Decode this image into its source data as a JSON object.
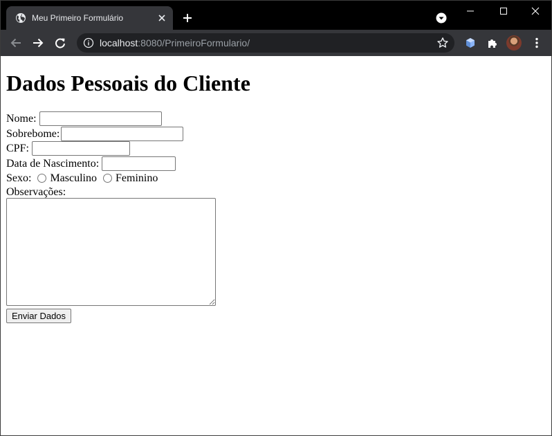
{
  "browser": {
    "tab_title": "Meu Primeiro Formulário",
    "url_host": "localhost",
    "url_rest": ":8080/PrimeiroFormulario/"
  },
  "page": {
    "heading": "Dados Pessoais do Cliente",
    "form": {
      "nome_label": "Nome:",
      "sobrenome_label": "Sobrebome:",
      "cpf_label": "CPF:",
      "nascimento_label": "Data de Nascimento:",
      "sexo_label": "Sexo:",
      "masculino_label": "Masculino",
      "feminino_label": "Feminino",
      "observacoes_label": "Observações:",
      "submit_label": "Enviar Dados",
      "nome_value": "",
      "sobrenome_value": "",
      "cpf_value": "",
      "nascimento_value": "",
      "observacoes_value": ""
    }
  },
  "icons": {
    "tab": "globe-icon",
    "tab_close": "close-icon",
    "new_tab": "plus-icon",
    "tab_search": "tab-search-icon",
    "back": "arrow-back-icon",
    "forward": "arrow-forward-icon",
    "reload": "reload-icon",
    "site_info": "info-icon",
    "bookmark": "star-icon",
    "extension": "cube-extension-icon",
    "extensions": "puzzle-icon",
    "menu": "kebab-menu-icon"
  },
  "colors": {
    "tabstrip": "#000000",
    "toolbar": "#35363a",
    "omnibox": "#202124"
  }
}
